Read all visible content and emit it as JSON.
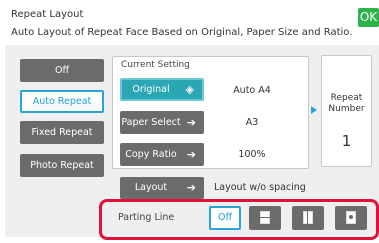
{
  "header": {
    "title": "Repeat Layout",
    "subtitle": "Auto Layout of Repeat Face Based on Original, Paper Size and Ratio.",
    "ok_label": "OK"
  },
  "modes": [
    {
      "label": "Off"
    },
    {
      "label": "Auto Repeat"
    },
    {
      "label": "Fixed Repeat"
    },
    {
      "label": "Photo Repeat"
    }
  ],
  "current_setting": {
    "label": "Current Setting",
    "original_label": "Original",
    "original_value": "Auto  A4",
    "paper_select_label": "Paper Select",
    "paper_select_value": "A3",
    "copy_ratio_label": "Copy Ratio",
    "copy_ratio_value": "100%"
  },
  "repeat": {
    "label": "Repeat Number",
    "value": "1"
  },
  "layout": {
    "label": "Layout",
    "value": "Layout w/o spacing"
  },
  "parting_line": {
    "label": "Parting Line",
    "off_label": "Off"
  },
  "colors": {
    "accent": "#2aa3db",
    "ok": "#2fb24c",
    "highlight_frame": "#e0123a"
  }
}
